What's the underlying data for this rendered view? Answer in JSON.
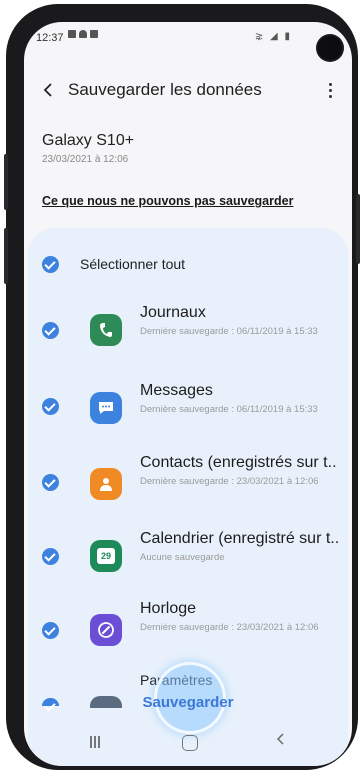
{
  "status_bar": {
    "time": "12:37",
    "system_icons": "⋧ ◢ ▮"
  },
  "header": {
    "title": "Sauvegarder les données"
  },
  "device": {
    "name": "Galaxy S10+",
    "date": "23/03/2021 à 12:06"
  },
  "cant_backup_link": "Ce que nous ne pouvons pas sauvegarder",
  "select_all": {
    "label": "Sélectionner tout",
    "checked": true
  },
  "items": [
    {
      "title": "Journaux",
      "subtitle": "Dernière sauvegarde : 06/11/2019 à 15:33",
      "icon": "phone-icon",
      "color": "#2e8b57",
      "checked": true
    },
    {
      "title": "Messages",
      "subtitle": "Dernière sauvegarde : 06/11/2019 à 15:33",
      "icon": "message-icon",
      "color": "#3d82de",
      "checked": true
    },
    {
      "title": "Contacts (enregistrés sur t..",
      "subtitle": "Dernière sauvegarde : 23/03/2021 à 12:06",
      "icon": "contact-icon",
      "color": "#f08a24",
      "checked": true
    },
    {
      "title": "Calendrier (enregistré sur t..",
      "subtitle": "Aucune sauvegarde",
      "icon": "calendar-icon",
      "color": "#1e8a5a",
      "checked": true
    },
    {
      "title": "Horloge",
      "subtitle": "Dernière sauvegarde : 23/03/2021 à 12:06",
      "icon": "clock-icon",
      "color": "#6a4fd6",
      "checked": true
    },
    {
      "title": "Paramètres",
      "subtitle": "",
      "icon": "settings-icon",
      "color": "#5b6b80",
      "checked": true
    }
  ],
  "calendar_day": "29",
  "action": {
    "save_label": "Sauvegarder"
  },
  "colors": {
    "accent": "#3d82de",
    "card_bg": "#e8f1fb",
    "screen_bg": "#f6f6f8"
  }
}
